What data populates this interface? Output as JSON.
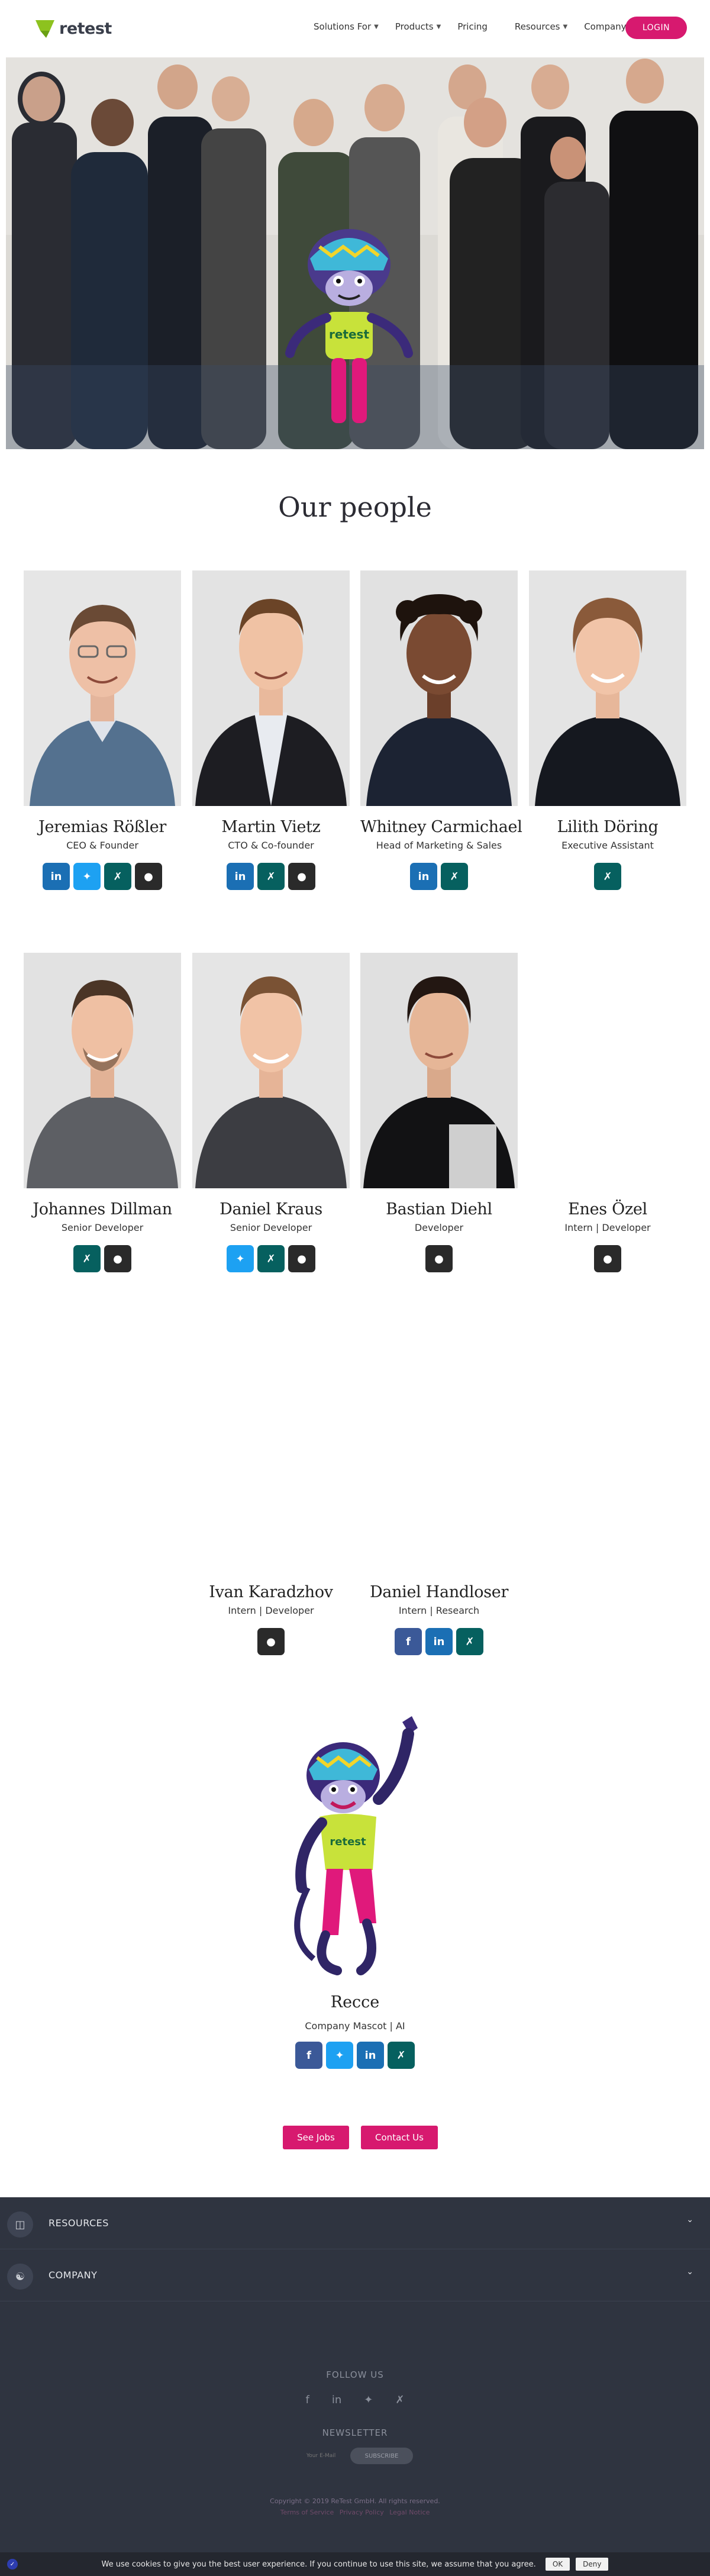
{
  "header": {
    "logo_text": "retest",
    "nav": [
      {
        "label": "Solutions For",
        "has_dropdown": true
      },
      {
        "label": "Products",
        "has_dropdown": true
      },
      {
        "label": "Pricing",
        "has_dropdown": false
      },
      {
        "label": "Resources",
        "has_dropdown": true
      },
      {
        "label": "Company",
        "has_dropdown": true
      }
    ],
    "login_label": "LOGIN"
  },
  "hero": {
    "mascot_shirt_text": "retest"
  },
  "people_title": "Our people",
  "people": [
    {
      "name": "Jeremias Rößler",
      "role": "CEO & Founder",
      "icons": [
        "linkedin",
        "twitter",
        "xing",
        "github"
      ],
      "photo": true
    },
    {
      "name": "Martin Vietz",
      "role": "CTO & Co-founder",
      "icons": [
        "linkedin",
        "xing",
        "github"
      ],
      "photo": true
    },
    {
      "name": "Whitney Carmichael",
      "role": "Head of Marketing & Sales",
      "icons": [
        "linkedin",
        "xing"
      ],
      "photo": true
    },
    {
      "name": "Lilith Döring",
      "role": "Executive Assistant",
      "icons": [
        "xing"
      ],
      "photo": true
    },
    {
      "name": "Johannes Dillman",
      "role": "Senior Developer",
      "icons": [
        "xing",
        "github"
      ],
      "photo": true
    },
    {
      "name": "Daniel Kraus",
      "role": "Senior Developer",
      "icons": [
        "twitter",
        "xing",
        "github"
      ],
      "photo": true
    },
    {
      "name": "Bastian Diehl",
      "role": "Developer",
      "icons": [
        "github"
      ],
      "photo": true
    },
    {
      "name": "Enes Özel",
      "role": "Intern | Developer",
      "icons": [
        "github"
      ],
      "photo": false
    },
    {
      "name": "Ivan Karadzhov",
      "role": "Intern | Developer",
      "icons": [
        "github"
      ],
      "photo": false
    },
    {
      "name": "Daniel Handloser",
      "role": "Intern | Research",
      "icons": [
        "facebook",
        "linkedin",
        "xing"
      ],
      "photo": false
    }
  ],
  "mascot": {
    "name": "Recce",
    "role": "Company Mascot | AI",
    "shirt_text": "retest",
    "icons": [
      "facebook",
      "twitter",
      "linkedin",
      "xing"
    ]
  },
  "cta": {
    "jobs_label": "See Jobs",
    "contact_label": "Contact Us"
  },
  "footer": {
    "sections": [
      {
        "label": "RESOURCES",
        "icon": "shopping-bag-icon"
      },
      {
        "label": "COMPANY",
        "icon": "people-icon"
      }
    ],
    "follow_label": "FOLLOW US",
    "social": [
      "facebook-icon",
      "linkedin-icon",
      "twitter-icon",
      "xing-icon"
    ],
    "newsletter_label": "NEWSLETTER",
    "newsletter_placeholder": "Your E-Mail",
    "subscribe_label": "SUBSCRIBE",
    "copyright": "Copyright © 2019 ReTest GmbH. All rights reserved.",
    "links": [
      "Terms of Service",
      "Privacy Policy",
      "Legal Notice"
    ]
  },
  "cookie": {
    "text": "We use cookies to give you the best user experience. If you continue to use this site, we assume that you agree.",
    "ok_label": "OK",
    "deny_label": "Deny"
  },
  "colors": {
    "accent": "#d7196f",
    "brand_green": "#8dc21f",
    "footer_bg": "#2f3440",
    "linkedin": "#1b6fb4",
    "twitter": "#1da1f2",
    "xing": "#06605f",
    "github": "#2a2a2a",
    "facebook": "#3b5998"
  }
}
